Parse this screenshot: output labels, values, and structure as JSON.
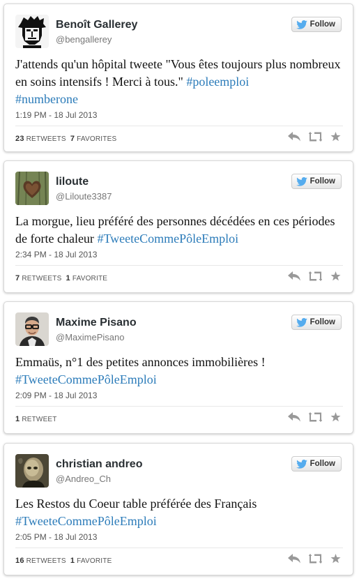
{
  "follow_label": "Follow",
  "tweets": [
    {
      "name": "Benoît Gallerey",
      "handle": "@bengallerey",
      "text": "J'attends qu'un hôpital tweete \"Vous êtes toujours plus nombreux en soins intensifs ! Merci à tous.\" ",
      "hashtags": [
        "#poleemploi",
        "#numberone"
      ],
      "timestamp": "1:19 PM - 18 Jul 2013",
      "retweets_count": "23",
      "retweets_label": "RETWEETS",
      "favorites_count": "7",
      "favorites_label": "FAVORITES"
    },
    {
      "name": "liloute",
      "handle": "@Liloute3387",
      "text": "La morgue, lieu préféré des personnes décédées en ces périodes de forte chaleur ",
      "hashtags": [
        "#TweeteCommePôleEmploi"
      ],
      "timestamp": "2:34 PM - 18 Jul 2013",
      "retweets_count": "7",
      "retweets_label": "RETWEETS",
      "favorites_count": "1",
      "favorites_label": "FAVORITE"
    },
    {
      "name": "Maxime Pisano",
      "handle": "@MaximePisano",
      "text": "Emmaüs, n°1 des petites annonces immobilières ! ",
      "hashtags": [
        "#TweeteCommePôleEmploi"
      ],
      "timestamp": "2:09 PM - 18 Jul 2013",
      "retweets_count": "1",
      "retweets_label": "RETWEET",
      "favorites_count": "",
      "favorites_label": ""
    },
    {
      "name": "christian andreo",
      "handle": "@Andreo_Ch",
      "text": "Les Restos du Coeur table préférée des Français ",
      "hashtags": [
        "#TweeteCommePôleEmploi"
      ],
      "timestamp": "2:05 PM - 18 Jul 2013",
      "retweets_count": "16",
      "retweets_label": "RETWEETS",
      "favorites_count": "1",
      "favorites_label": "FAVORITE"
    }
  ],
  "icons": {
    "follow": "twitter-bird-icon",
    "reply": "reply-icon",
    "retweet": "retweet-icon",
    "favorite": "star-icon"
  },
  "colors": {
    "hashtag": "#2b7bb9",
    "icon": "#999999"
  }
}
